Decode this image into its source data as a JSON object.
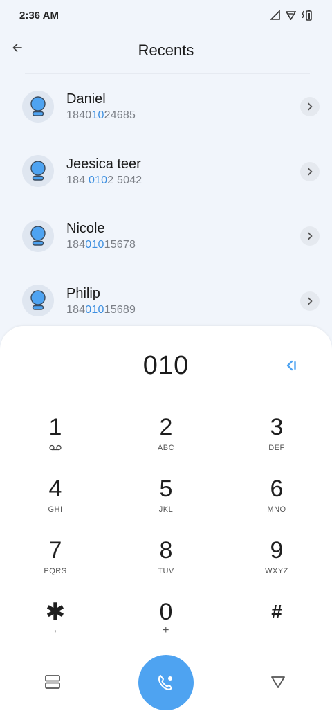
{
  "status_bar": {
    "time": "2:36 AM"
  },
  "header": {
    "title": "Recents"
  },
  "contacts": [
    {
      "name": "Daniel",
      "number_parts": [
        "1840",
        "10",
        "24685"
      ]
    },
    {
      "name": "Jeesica teer",
      "number_parts": [
        "184 ",
        "010",
        "2 5042"
      ]
    },
    {
      "name": "Nicole",
      "number_parts": [
        "184",
        "010",
        "15678"
      ]
    },
    {
      "name": "Philip",
      "number_parts": [
        "184",
        "010",
        "15689"
      ]
    }
  ],
  "dialer": {
    "input_value": "010",
    "keys": [
      [
        {
          "digit": "1",
          "letters": ""
        },
        {
          "digit": "2",
          "letters": "ABC"
        },
        {
          "digit": "3",
          "letters": "DEF"
        }
      ],
      [
        {
          "digit": "4",
          "letters": "GHI"
        },
        {
          "digit": "5",
          "letters": "JKL"
        },
        {
          "digit": "6",
          "letters": "MNO"
        }
      ],
      [
        {
          "digit": "7",
          "letters": "PQRS"
        },
        {
          "digit": "8",
          "letters": "TUV"
        },
        {
          "digit": "9",
          "letters": "WXYZ"
        }
      ],
      [
        {
          "digit": "✱",
          "letters": ","
        },
        {
          "digit": "0",
          "letters": "+"
        },
        {
          "digit": "#",
          "letters": ""
        }
      ]
    ]
  },
  "icons": {
    "back": "arrow-left-icon",
    "chevron": "chevron-right-icon",
    "backspace": "backspace-icon",
    "voicemail": "voicemail-icon",
    "grid": "grid-icon",
    "call": "call-icon",
    "hide_keypad": "triangle-down-icon"
  },
  "colors": {
    "accent": "#4ea3f1",
    "highlight": "#3d8fe0",
    "background": "#f1f5fb"
  }
}
